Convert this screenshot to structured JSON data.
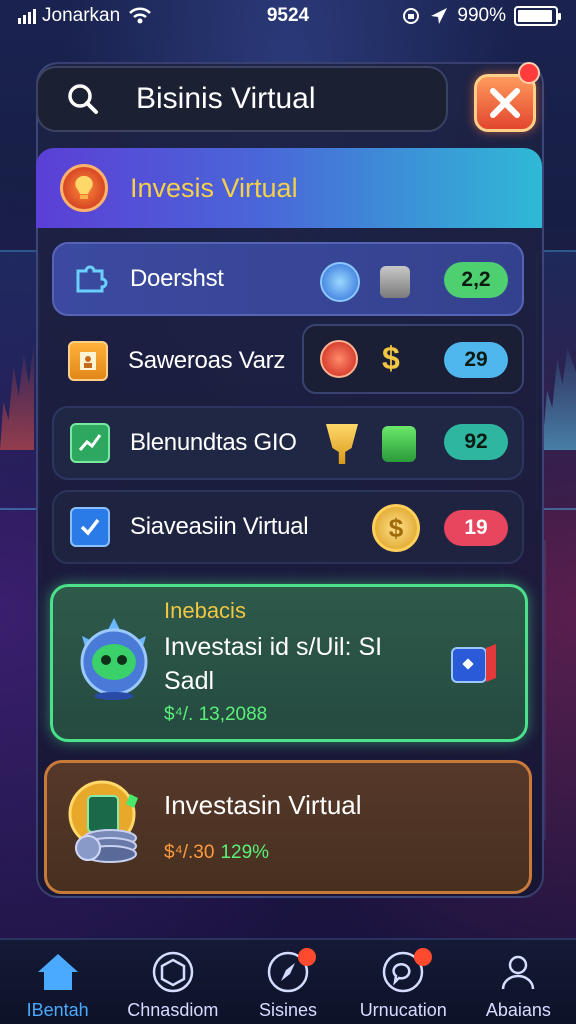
{
  "status_bar": {
    "carrier": "Jonarkan",
    "time": "9524",
    "battery": "990%"
  },
  "search": {
    "value": "Bisinis Virtual"
  },
  "header": {
    "title": "Invesis Virtual"
  },
  "list": [
    {
      "label": "Doershst",
      "badge": "2,2",
      "badge_color": "#4fd070"
    },
    {
      "label": "Saweroas Varz",
      "badge": "29",
      "badge_color": "#4fb6ee"
    },
    {
      "label": "Blenundtas GIO",
      "badge": "92",
      "badge_color": "#2fb6a0"
    },
    {
      "label": "Siaveasiin Virtual",
      "badge": "19",
      "badge_color": "#e8455e"
    }
  ],
  "feature_green": {
    "kicker": "Inebacis",
    "title": "Investasi id s/Uil: SI Sadl",
    "amount": "$⁴/. 13,2088"
  },
  "feature_orange": {
    "title": "Investasin Virtual",
    "amount": "$⁴/.30",
    "percent": "129%"
  },
  "nav": [
    {
      "label": "IBentah",
      "icon": "home-icon"
    },
    {
      "label": "Chnasdiom",
      "icon": "cube-icon"
    },
    {
      "label": "Sisines",
      "icon": "compass-icon"
    },
    {
      "label": "Urnucation",
      "icon": "chat-icon"
    },
    {
      "label": "Abaians",
      "icon": "user-icon"
    }
  ],
  "colors": {
    "accent": "#4aaaff",
    "green": "#4be08a",
    "orange": "#c87a3a"
  }
}
